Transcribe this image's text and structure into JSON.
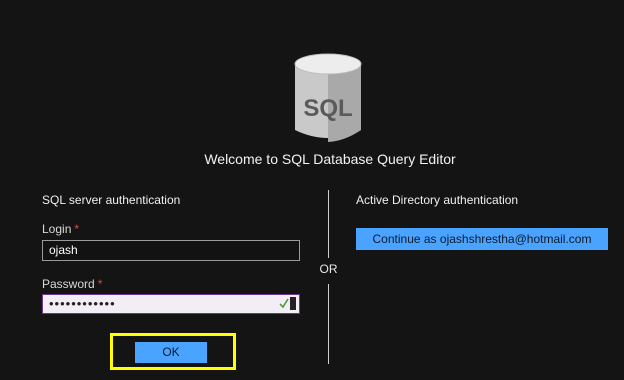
{
  "logo": {
    "text": "SQL"
  },
  "title": "Welcome to SQL Database Query Editor",
  "sql_auth": {
    "heading": "SQL server authentication",
    "login_label": "Login",
    "login_value": "ojash",
    "password_label": "Password",
    "password_value": "••••••••••••",
    "required_mark": "*",
    "ok_label": "OK"
  },
  "separator_label": "OR",
  "ad_auth": {
    "heading": "Active Directory authentication",
    "continue_label": "Continue as ojashshrestha@hotmail.com"
  },
  "colors": {
    "accent": "#4aa4ff",
    "highlight": "#ffff00",
    "required": "#e0483a"
  }
}
